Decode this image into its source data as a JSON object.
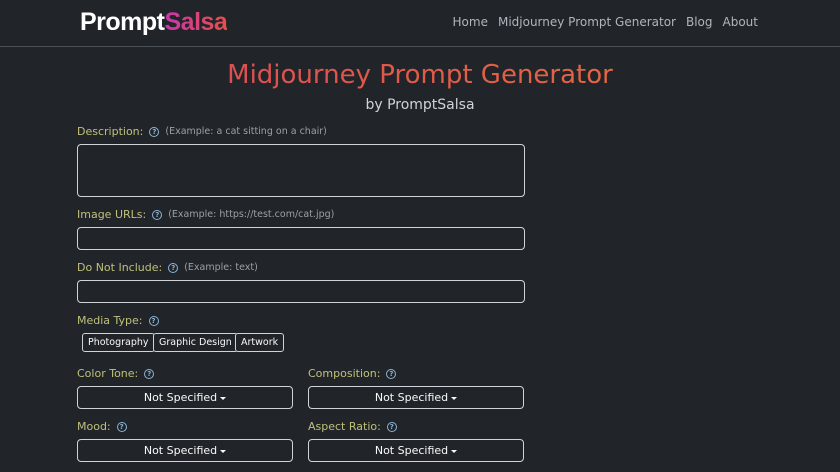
{
  "brand": {
    "part1": "Prompt",
    "part2": "Salsa"
  },
  "nav": {
    "items": [
      "Home",
      "Midjourney Prompt Generator",
      "Blog",
      "About"
    ]
  },
  "header": {
    "title": "Midjourney Prompt Generator",
    "subtitle": "by PromptSalsa"
  },
  "form": {
    "description": {
      "label": "Description:",
      "example": "(Example: a cat sitting on a chair)",
      "value": ""
    },
    "image_urls": {
      "label": "Image URLs:",
      "example": "(Example: https://test.com/cat.jpg)",
      "value": ""
    },
    "do_not_include": {
      "label": "Do Not Include:",
      "example": "(Example: text)",
      "value": ""
    },
    "media_type": {
      "label": "Media Type:",
      "options": [
        "Photography",
        "Graphic Design",
        "Artwork"
      ]
    },
    "color_tone": {
      "label": "Color Tone:",
      "selected": "Not Specified"
    },
    "composition": {
      "label": "Composition:",
      "selected": "Not Specified"
    },
    "mood": {
      "label": "Mood:",
      "selected": "Not Specified"
    },
    "aspect_ratio": {
      "label": "Aspect Ratio:",
      "selected": "Not Specified"
    },
    "help_glyph": "?"
  },
  "colors": {
    "background": "#212529",
    "label": "#bfc07a",
    "help": "#8ab4d6"
  }
}
